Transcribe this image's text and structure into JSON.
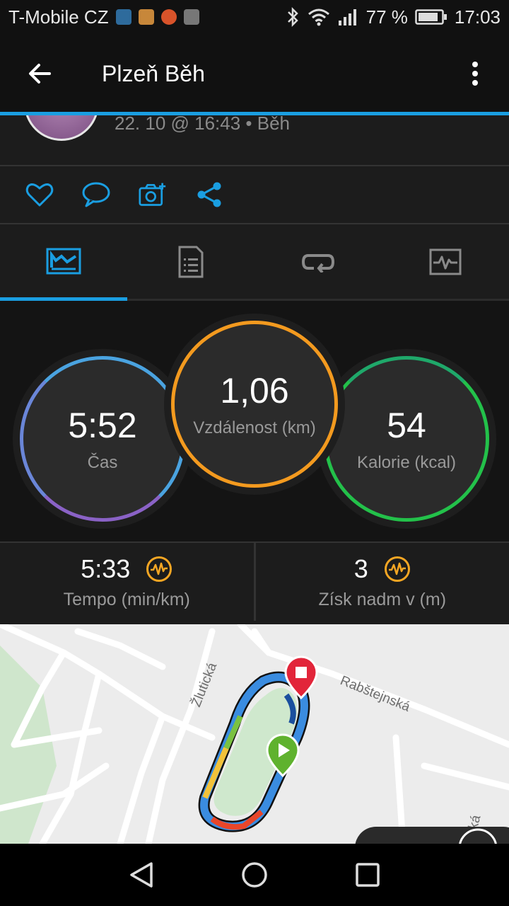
{
  "status_bar": {
    "carrier": "T-Mobile CZ",
    "battery": "77 %",
    "time": "17:03",
    "icons": [
      "bluetooth-icon",
      "wifi-icon",
      "signal-icon",
      "battery-icon"
    ]
  },
  "app_bar": {
    "title": "Plzeň Běh",
    "back_icon": "arrow-back-icon",
    "more_icon": "more-vert-icon"
  },
  "activity": {
    "meta": "22. 10 @ 16:43 • Běh"
  },
  "actions": [
    "like-icon",
    "comment-icon",
    "add-photo-icon",
    "share-icon"
  ],
  "tabs": [
    {
      "name": "overview",
      "icon": "overview-chart-icon",
      "active": true
    },
    {
      "name": "details",
      "icon": "details-list-icon",
      "active": false
    },
    {
      "name": "laps",
      "icon": "laps-loop-icon",
      "active": false
    },
    {
      "name": "charts",
      "icon": "charts-pulse-icon",
      "active": false
    }
  ],
  "stats": {
    "time": {
      "value": "5:52",
      "label": "Čas"
    },
    "distance": {
      "value": "1,06",
      "label": "Vzdálenost (km)"
    },
    "calories": {
      "value": "54",
      "label": "Kalorie (kcal)"
    }
  },
  "metrics": {
    "pace": {
      "value": "5:33",
      "label": "Tempo (min/km)"
    },
    "elevation": {
      "value": "3",
      "label": "Získ nadm v (m)"
    }
  },
  "map": {
    "streets": [
      "Žlutická",
      "Rabštejnská",
      "ská"
    ]
  },
  "colors": {
    "accent": "#1a9ee1",
    "time_ring": "#4aa3e0",
    "distance_ring": "#f39a1f",
    "calories_ring": "#23c14a",
    "metric_icon": "#f5a623"
  }
}
